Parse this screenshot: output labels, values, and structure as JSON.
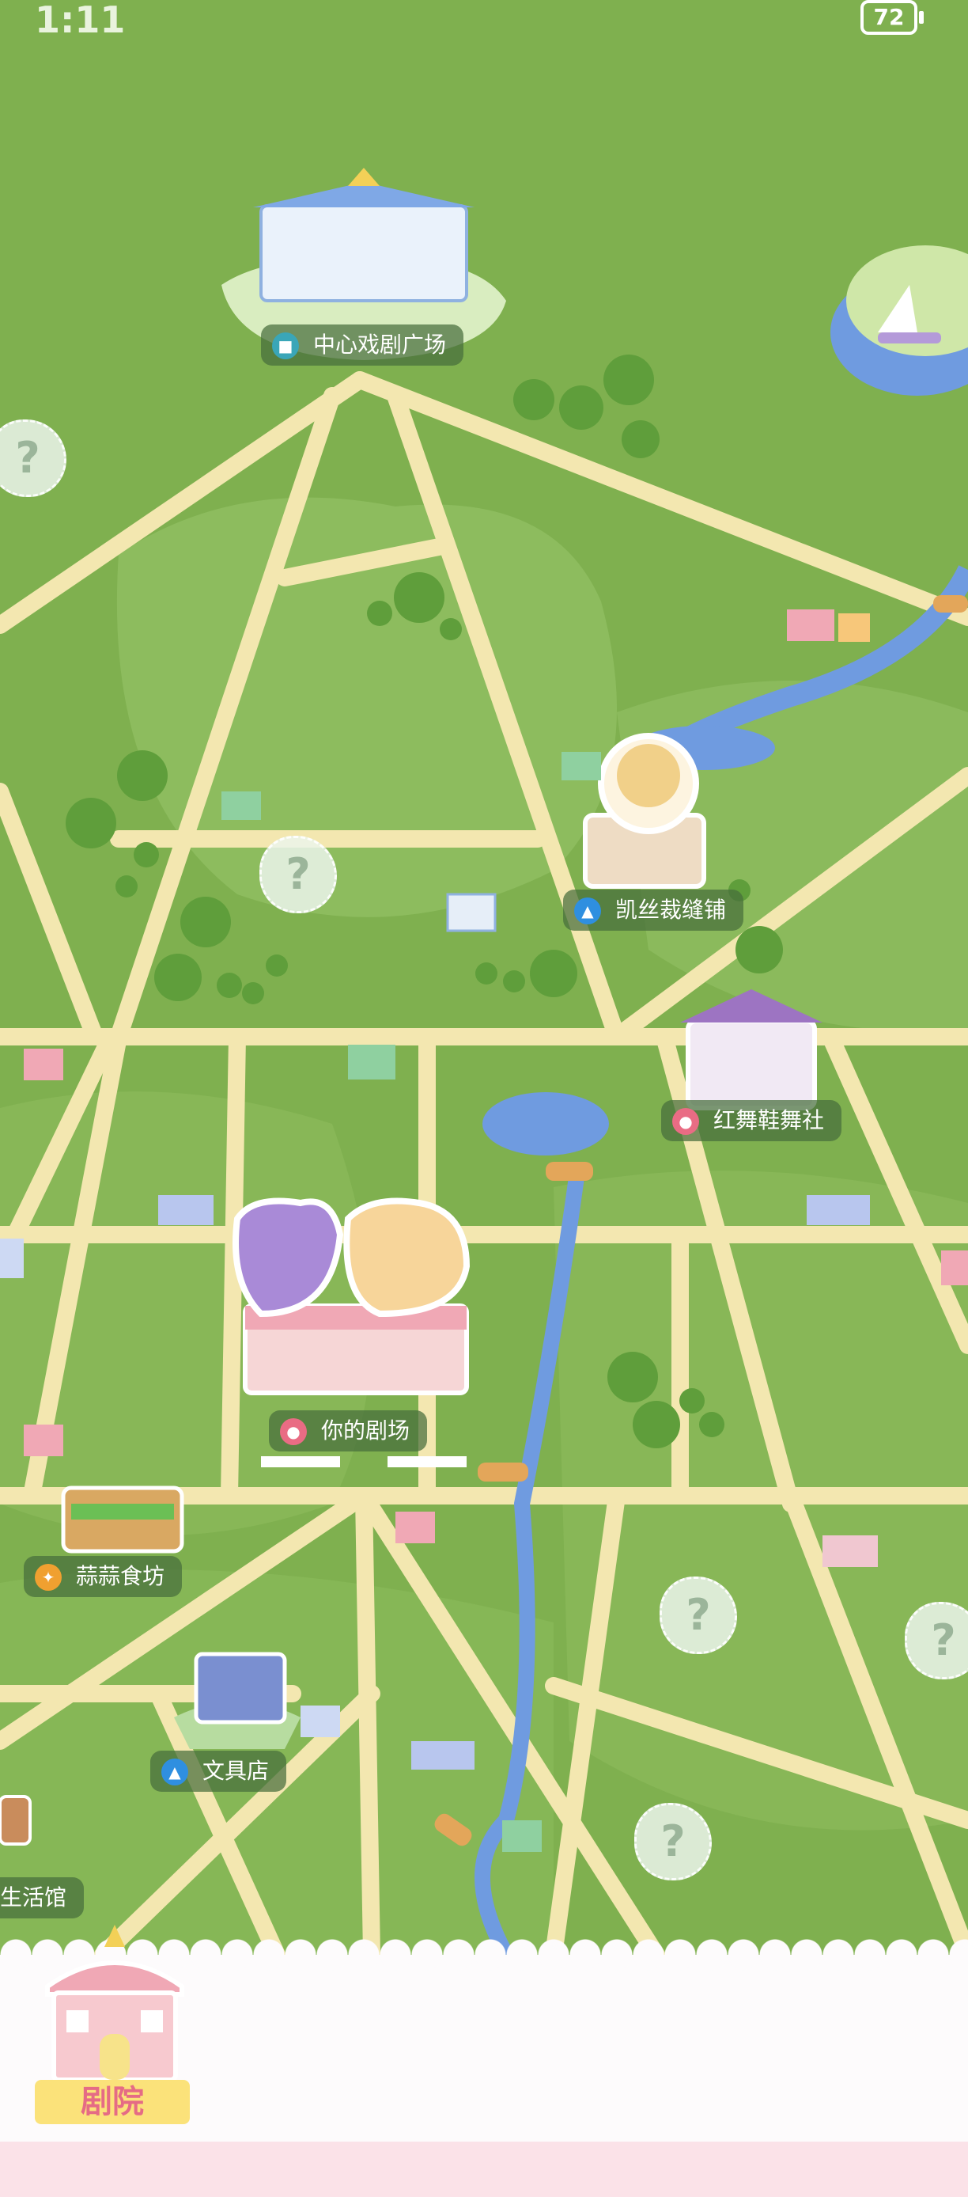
{
  "status_bar": {
    "time": "1:11",
    "battery": "72"
  },
  "locations": {
    "central_square": "中心戏剧广场",
    "kais_tailor": "凯丝裁缝铺",
    "red_shoes": "红舞鞋舞社",
    "your_theater": "你的剧场",
    "garlic_kitchen": "蒜蒜食坊",
    "stationery": "文具店",
    "life_hall": "生活馆"
  },
  "unknown_marker": "?",
  "bottom_tab": {
    "label": "剧院"
  },
  "colors": {
    "grass": "#7fb04f",
    "road": "#f3e7b0",
    "water": "#6f9be0",
    "pink": "#e96c84"
  }
}
